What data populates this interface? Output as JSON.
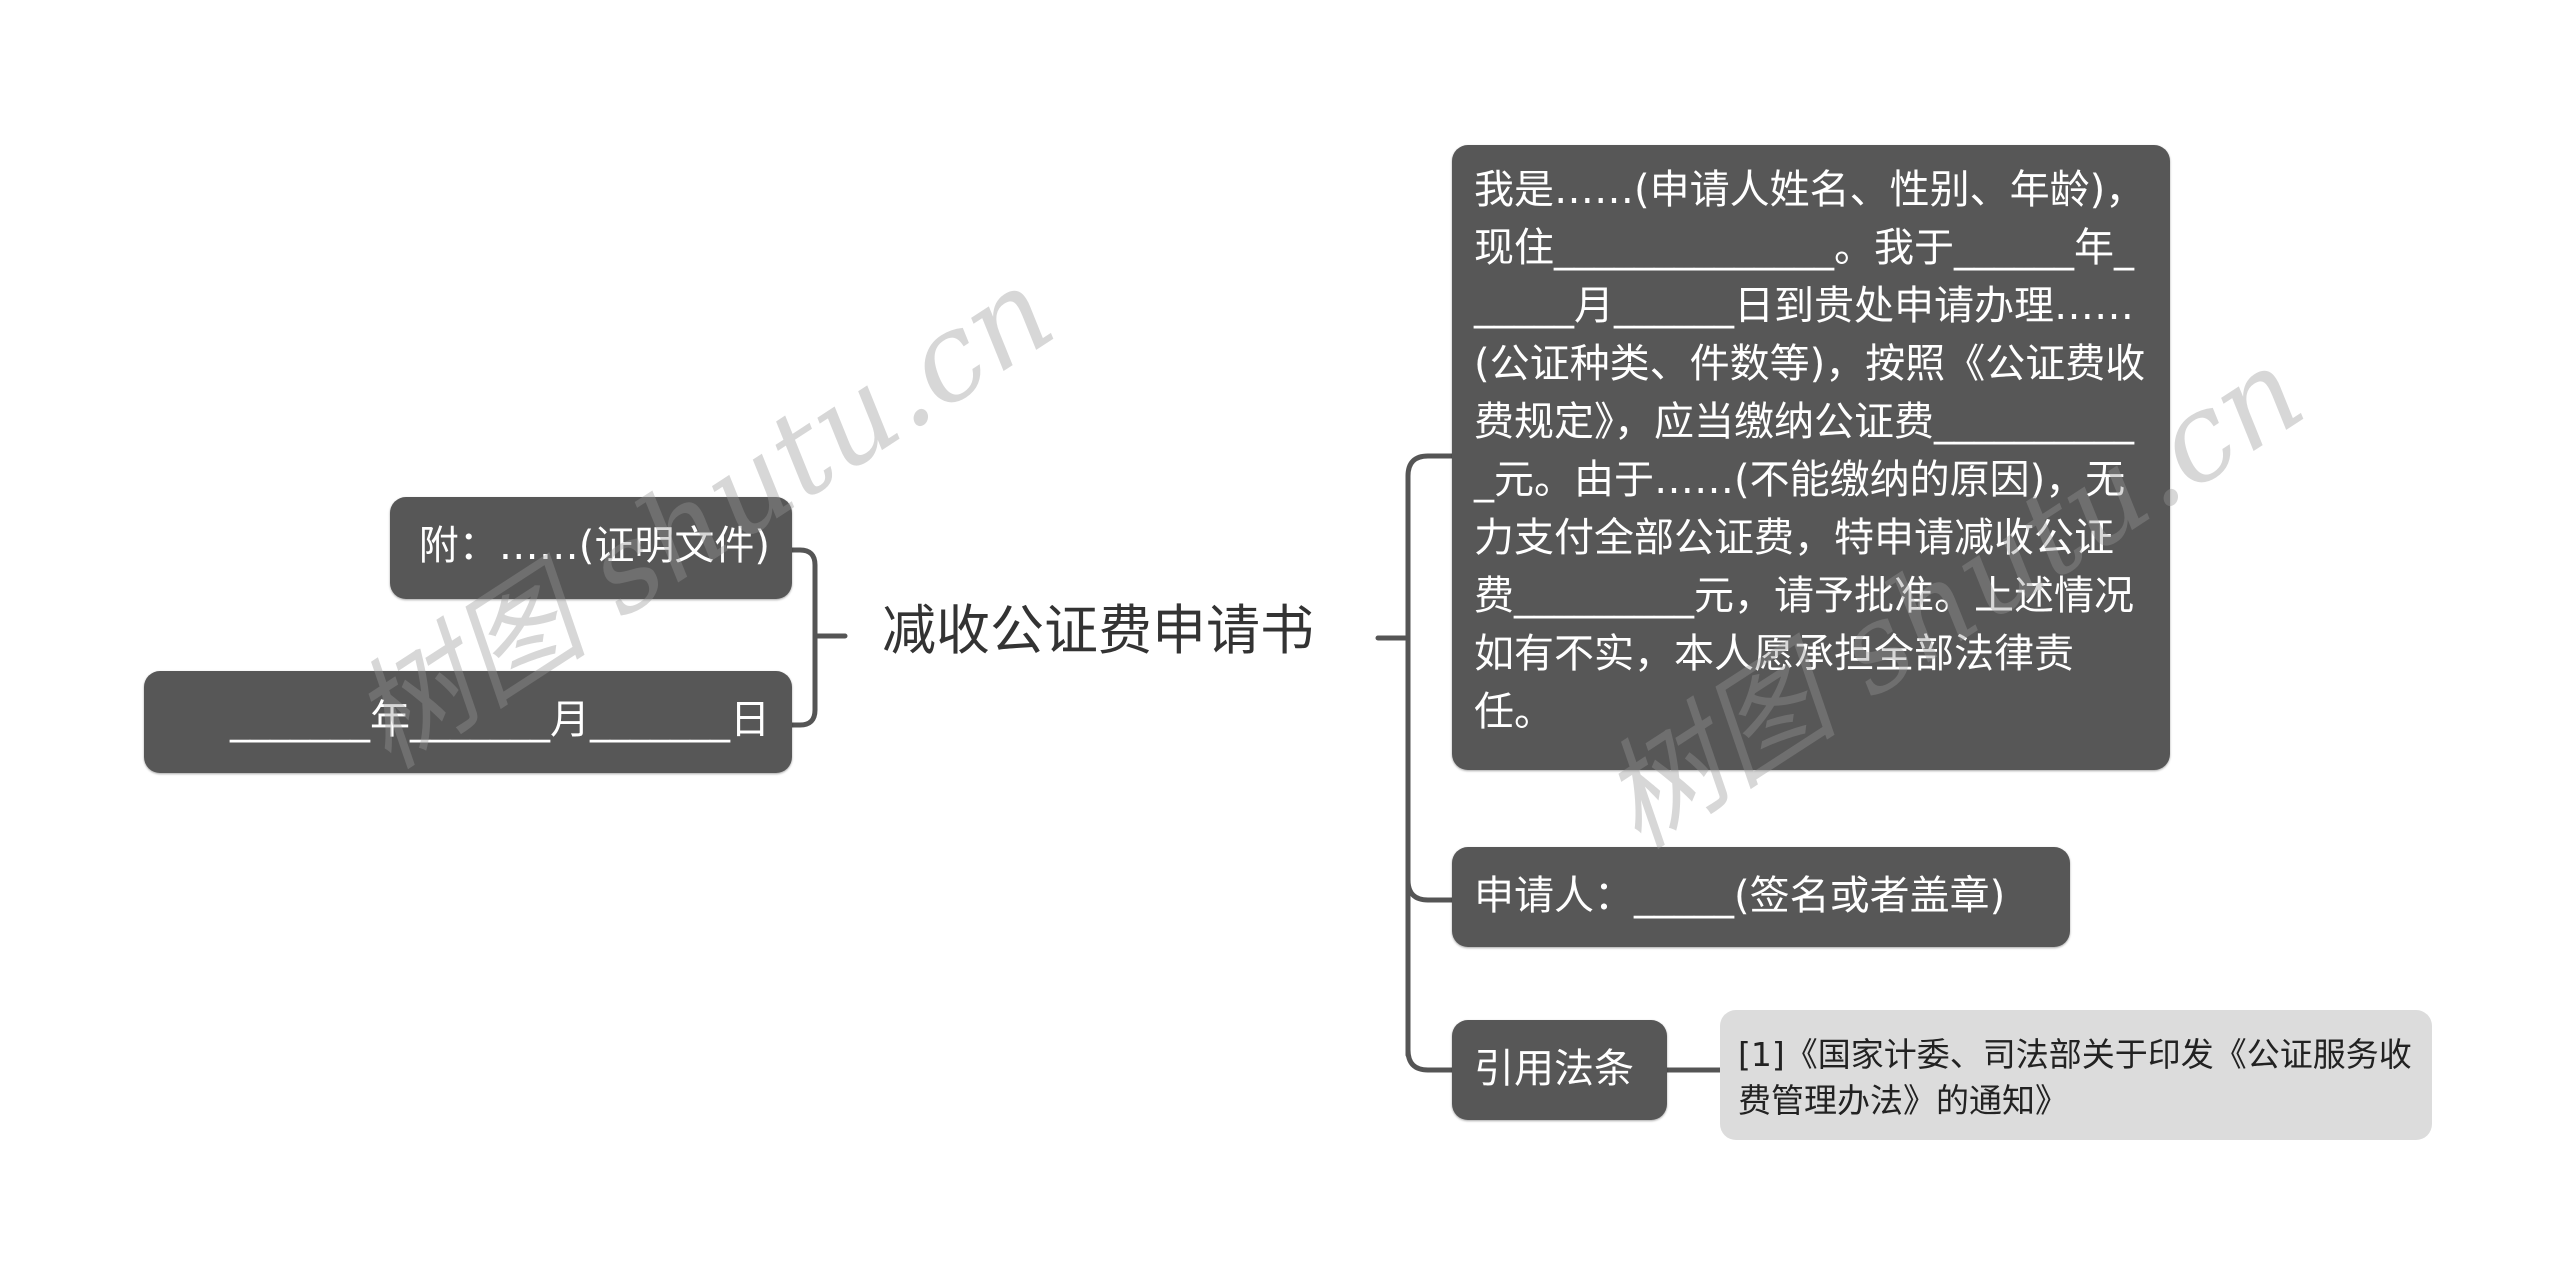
{
  "mindmap": {
    "root": {
      "title": "减收公证费申请书"
    },
    "right_branches": [
      {
        "text": "我是……(申请人姓名、性别、年龄)，现住______________。我于______年______月______日到贵处申请办理……(公证种类、件数等)，按照《公证费收费规定》，应当缴纳公证费___________元。由于……(不能缴纳的原因)，无力支付全部公证费，特申请减收公证费_________元，请予批准。上述情况如有不实，本人愿承担全部法律责任。"
      },
      {
        "text": "申请人：_____(签名或者盖章)"
      },
      {
        "text": "引用法条",
        "children": [
          {
            "text": "[1]《国家计委、司法部关于印发《公证服务收费管理办法》的通知》"
          }
        ]
      }
    ],
    "left_branches": [
      {
        "text": "附：……(证明文件)"
      },
      {
        "text": "_______年_______月_______日"
      }
    ]
  },
  "watermark": {
    "text": "树图 shutu.cn"
  },
  "colors": {
    "node_fill": "#575757",
    "node_text": "#ffffff",
    "leaf_fill": "#dcdcdc",
    "leaf_text": "#222222",
    "connector": "#555555",
    "root_text": "#333333"
  }
}
